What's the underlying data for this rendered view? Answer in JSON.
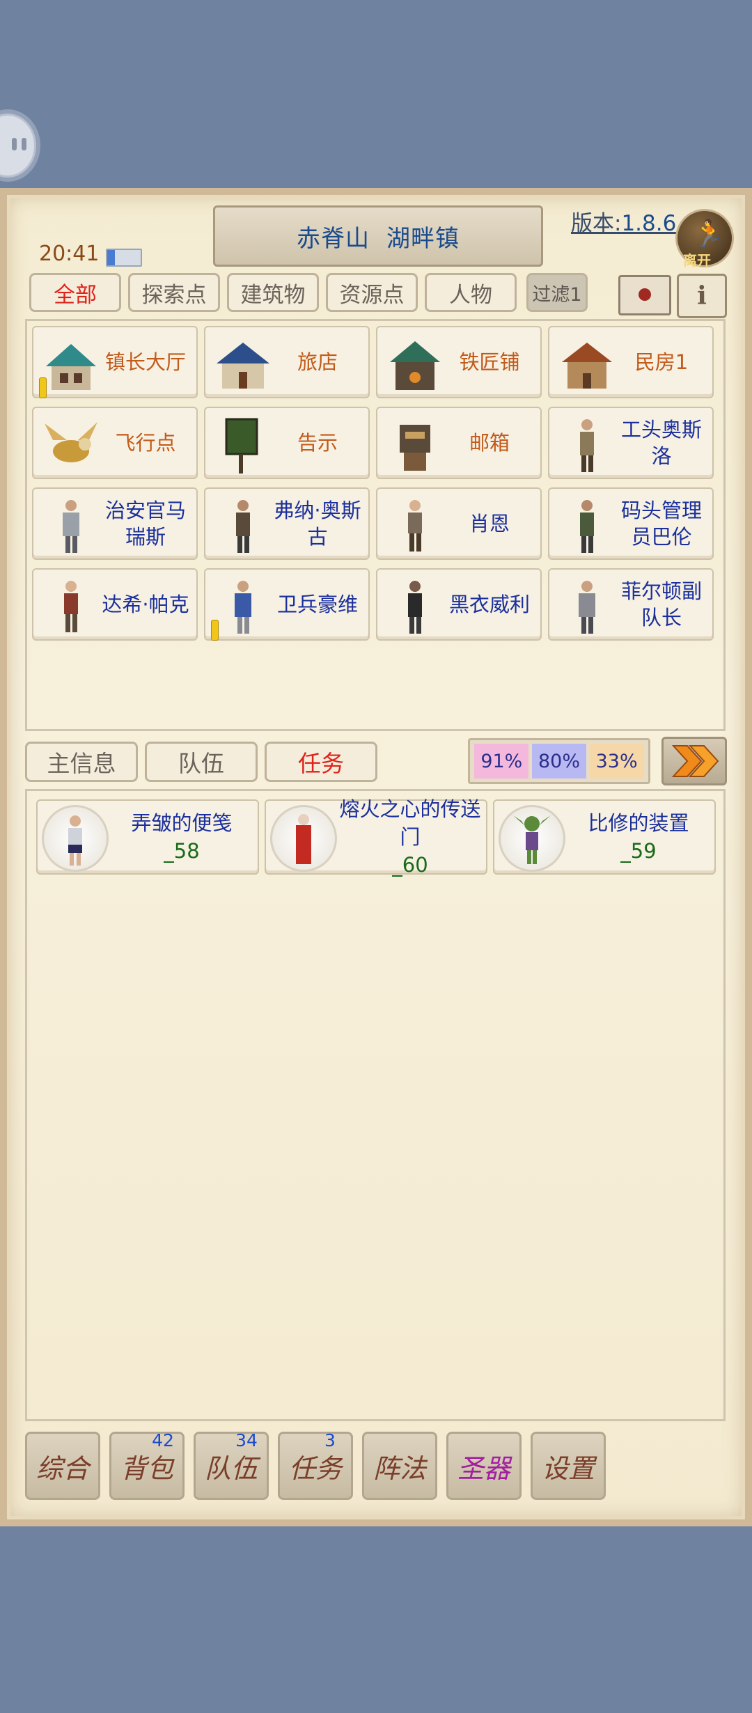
{
  "header": {
    "region": "赤脊山",
    "town": "湖畔镇",
    "clock": "20:41",
    "battery_level": 0.22,
    "version_label": "版本:",
    "version_num": "1.8.6",
    "leave_label": "离开"
  },
  "filter_tabs": [
    "全部",
    "探索点",
    "建筑物",
    "资源点",
    "人物"
  ],
  "filter_button": "过滤1",
  "grid": {
    "row1": [
      "镇长大厅",
      "旅店",
      "铁匠铺",
      "民房1"
    ],
    "row2": [
      "飞行点",
      "告示",
      "邮箱",
      "工头奥斯洛"
    ],
    "row3": [
      "治安官马瑞斯",
      "弗纳·奥斯古",
      "肖恩",
      "码头管理员巴伦"
    ],
    "row4": [
      "达希·帕克",
      "卫兵豪维",
      "黑衣威利",
      "菲尔顿副队长"
    ]
  },
  "sub_tabs": [
    "主信息",
    "队伍",
    "任务"
  ],
  "percentages": [
    "91%",
    "80%",
    "33%"
  ],
  "quests": [
    {
      "title": "弄皱的便笺",
      "level": "_58"
    },
    {
      "title": "熔火之心的传送门",
      "level": "_60"
    },
    {
      "title": "比修的装置",
      "level": "_59"
    }
  ],
  "bottom_nav": [
    "综合",
    "背包",
    "队伍",
    "任务",
    "阵法",
    "圣器",
    "设置"
  ],
  "badges": {
    "bag": "42",
    "team": "34",
    "task": "3"
  },
  "colors": {
    "active_tab": "#e0221b",
    "building_text": "#c25a1a",
    "person_text": "#1a2f9c",
    "level_text": "#1a6a1a",
    "holy_item": "#a21fa0"
  }
}
